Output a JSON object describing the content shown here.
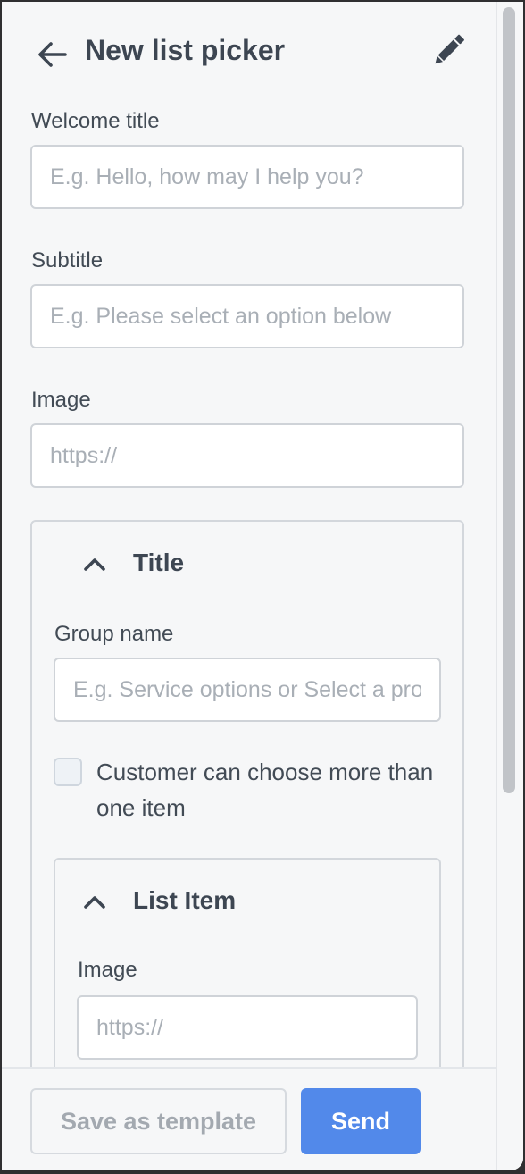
{
  "header": {
    "title": "New list picker",
    "back_icon": "arrow-left-icon",
    "edit_icon": "pencil-icon"
  },
  "form": {
    "welcome_title": {
      "label": "Welcome title",
      "value": "",
      "placeholder": "E.g. Hello, how may I help you?"
    },
    "subtitle": {
      "label": "Subtitle",
      "value": "",
      "placeholder": "E.g. Please select an option below"
    },
    "image": {
      "label": "Image",
      "value": "",
      "placeholder": "https://"
    }
  },
  "section": {
    "title": "Title",
    "expanded": true,
    "group_name": {
      "label": "Group name",
      "value": "",
      "placeholder": "E.g. Service options or Select a product"
    },
    "multi_select": {
      "label": "Customer can choose more than one item",
      "checked": false
    },
    "list_item": {
      "title": "List Item",
      "expanded": true,
      "image": {
        "label": "Image",
        "value": "",
        "placeholder": "https://"
      }
    }
  },
  "footer": {
    "save_template_label": "Save as template",
    "send_label": "Send"
  },
  "colors": {
    "primary": "#5289ea",
    "text": "#3d4652",
    "placeholder": "#a9afb6",
    "border": "#cfd3d8"
  }
}
